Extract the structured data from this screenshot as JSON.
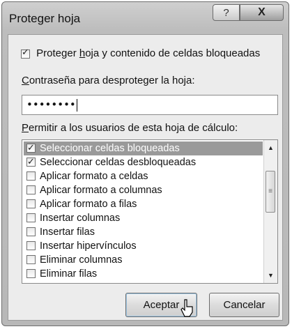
{
  "window": {
    "title": "Proteger hoja",
    "help_glyph": "?",
    "close_glyph": "X"
  },
  "protect": {
    "label_pre": "Proteger ",
    "label_h": "h",
    "label_post": "oja y contenido de celdas bloqueadas",
    "checked": true
  },
  "password": {
    "label_pre": "",
    "label_c": "C",
    "label_post": "ontraseña para desproteger la hoja:",
    "value": "••••••••"
  },
  "permissions": {
    "label_p": "P",
    "label_post": "ermitir a los usuarios de esta hoja de cálculo:",
    "items": [
      {
        "label": "Seleccionar celdas bloqueadas",
        "checked": true,
        "selected": true
      },
      {
        "label": "Seleccionar celdas desbloqueadas",
        "checked": true,
        "selected": false
      },
      {
        "label": "Aplicar formato a celdas",
        "checked": false,
        "selected": false
      },
      {
        "label": "Aplicar formato a columnas",
        "checked": false,
        "selected": false
      },
      {
        "label": "Aplicar formato a filas",
        "checked": false,
        "selected": false
      },
      {
        "label": "Insertar columnas",
        "checked": false,
        "selected": false
      },
      {
        "label": "Insertar filas",
        "checked": false,
        "selected": false
      },
      {
        "label": "Insertar hipervínculos",
        "checked": false,
        "selected": false
      },
      {
        "label": "Eliminar columnas",
        "checked": false,
        "selected": false
      },
      {
        "label": "Eliminar filas",
        "checked": false,
        "selected": false
      }
    ]
  },
  "buttons": {
    "ok": "Aceptar",
    "cancel": "Cancelar"
  },
  "icons": {
    "scroll_up": "▲",
    "scroll_down": "▼",
    "thumb_grip": "≡"
  }
}
